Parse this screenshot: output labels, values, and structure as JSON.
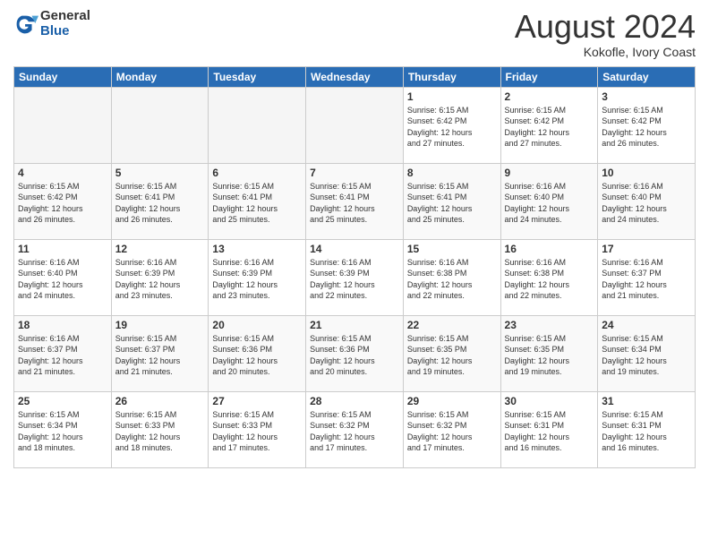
{
  "logo": {
    "general": "General",
    "blue": "Blue"
  },
  "title": "August 2024",
  "subtitle": "Kokofle, Ivory Coast",
  "days_of_week": [
    "Sunday",
    "Monday",
    "Tuesday",
    "Wednesday",
    "Thursday",
    "Friday",
    "Saturday"
  ],
  "weeks": [
    [
      {
        "day": "",
        "info": "",
        "empty": true
      },
      {
        "day": "",
        "info": "",
        "empty": true
      },
      {
        "day": "",
        "info": "",
        "empty": true
      },
      {
        "day": "",
        "info": "",
        "empty": true
      },
      {
        "day": "1",
        "info": "Sunrise: 6:15 AM\nSunset: 6:42 PM\nDaylight: 12 hours\nand 27 minutes.",
        "empty": false
      },
      {
        "day": "2",
        "info": "Sunrise: 6:15 AM\nSunset: 6:42 PM\nDaylight: 12 hours\nand 27 minutes.",
        "empty": false
      },
      {
        "day": "3",
        "info": "Sunrise: 6:15 AM\nSunset: 6:42 PM\nDaylight: 12 hours\nand 26 minutes.",
        "empty": false
      }
    ],
    [
      {
        "day": "4",
        "info": "Sunrise: 6:15 AM\nSunset: 6:42 PM\nDaylight: 12 hours\nand 26 minutes.",
        "empty": false
      },
      {
        "day": "5",
        "info": "Sunrise: 6:15 AM\nSunset: 6:41 PM\nDaylight: 12 hours\nand 26 minutes.",
        "empty": false
      },
      {
        "day": "6",
        "info": "Sunrise: 6:15 AM\nSunset: 6:41 PM\nDaylight: 12 hours\nand 25 minutes.",
        "empty": false
      },
      {
        "day": "7",
        "info": "Sunrise: 6:15 AM\nSunset: 6:41 PM\nDaylight: 12 hours\nand 25 minutes.",
        "empty": false
      },
      {
        "day": "8",
        "info": "Sunrise: 6:15 AM\nSunset: 6:41 PM\nDaylight: 12 hours\nand 25 minutes.",
        "empty": false
      },
      {
        "day": "9",
        "info": "Sunrise: 6:16 AM\nSunset: 6:40 PM\nDaylight: 12 hours\nand 24 minutes.",
        "empty": false
      },
      {
        "day": "10",
        "info": "Sunrise: 6:16 AM\nSunset: 6:40 PM\nDaylight: 12 hours\nand 24 minutes.",
        "empty": false
      }
    ],
    [
      {
        "day": "11",
        "info": "Sunrise: 6:16 AM\nSunset: 6:40 PM\nDaylight: 12 hours\nand 24 minutes.",
        "empty": false
      },
      {
        "day": "12",
        "info": "Sunrise: 6:16 AM\nSunset: 6:39 PM\nDaylight: 12 hours\nand 23 minutes.",
        "empty": false
      },
      {
        "day": "13",
        "info": "Sunrise: 6:16 AM\nSunset: 6:39 PM\nDaylight: 12 hours\nand 23 minutes.",
        "empty": false
      },
      {
        "day": "14",
        "info": "Sunrise: 6:16 AM\nSunset: 6:39 PM\nDaylight: 12 hours\nand 22 minutes.",
        "empty": false
      },
      {
        "day": "15",
        "info": "Sunrise: 6:16 AM\nSunset: 6:38 PM\nDaylight: 12 hours\nand 22 minutes.",
        "empty": false
      },
      {
        "day": "16",
        "info": "Sunrise: 6:16 AM\nSunset: 6:38 PM\nDaylight: 12 hours\nand 22 minutes.",
        "empty": false
      },
      {
        "day": "17",
        "info": "Sunrise: 6:16 AM\nSunset: 6:37 PM\nDaylight: 12 hours\nand 21 minutes.",
        "empty": false
      }
    ],
    [
      {
        "day": "18",
        "info": "Sunrise: 6:16 AM\nSunset: 6:37 PM\nDaylight: 12 hours\nand 21 minutes.",
        "empty": false
      },
      {
        "day": "19",
        "info": "Sunrise: 6:15 AM\nSunset: 6:37 PM\nDaylight: 12 hours\nand 21 minutes.",
        "empty": false
      },
      {
        "day": "20",
        "info": "Sunrise: 6:15 AM\nSunset: 6:36 PM\nDaylight: 12 hours\nand 20 minutes.",
        "empty": false
      },
      {
        "day": "21",
        "info": "Sunrise: 6:15 AM\nSunset: 6:36 PM\nDaylight: 12 hours\nand 20 minutes.",
        "empty": false
      },
      {
        "day": "22",
        "info": "Sunrise: 6:15 AM\nSunset: 6:35 PM\nDaylight: 12 hours\nand 19 minutes.",
        "empty": false
      },
      {
        "day": "23",
        "info": "Sunrise: 6:15 AM\nSunset: 6:35 PM\nDaylight: 12 hours\nand 19 minutes.",
        "empty": false
      },
      {
        "day": "24",
        "info": "Sunrise: 6:15 AM\nSunset: 6:34 PM\nDaylight: 12 hours\nand 19 minutes.",
        "empty": false
      }
    ],
    [
      {
        "day": "25",
        "info": "Sunrise: 6:15 AM\nSunset: 6:34 PM\nDaylight: 12 hours\nand 18 minutes.",
        "empty": false
      },
      {
        "day": "26",
        "info": "Sunrise: 6:15 AM\nSunset: 6:33 PM\nDaylight: 12 hours\nand 18 minutes.",
        "empty": false
      },
      {
        "day": "27",
        "info": "Sunrise: 6:15 AM\nSunset: 6:33 PM\nDaylight: 12 hours\nand 17 minutes.",
        "empty": false
      },
      {
        "day": "28",
        "info": "Sunrise: 6:15 AM\nSunset: 6:32 PM\nDaylight: 12 hours\nand 17 minutes.",
        "empty": false
      },
      {
        "day": "29",
        "info": "Sunrise: 6:15 AM\nSunset: 6:32 PM\nDaylight: 12 hours\nand 17 minutes.",
        "empty": false
      },
      {
        "day": "30",
        "info": "Sunrise: 6:15 AM\nSunset: 6:31 PM\nDaylight: 12 hours\nand 16 minutes.",
        "empty": false
      },
      {
        "day": "31",
        "info": "Sunrise: 6:15 AM\nSunset: 6:31 PM\nDaylight: 12 hours\nand 16 minutes.",
        "empty": false
      }
    ]
  ]
}
